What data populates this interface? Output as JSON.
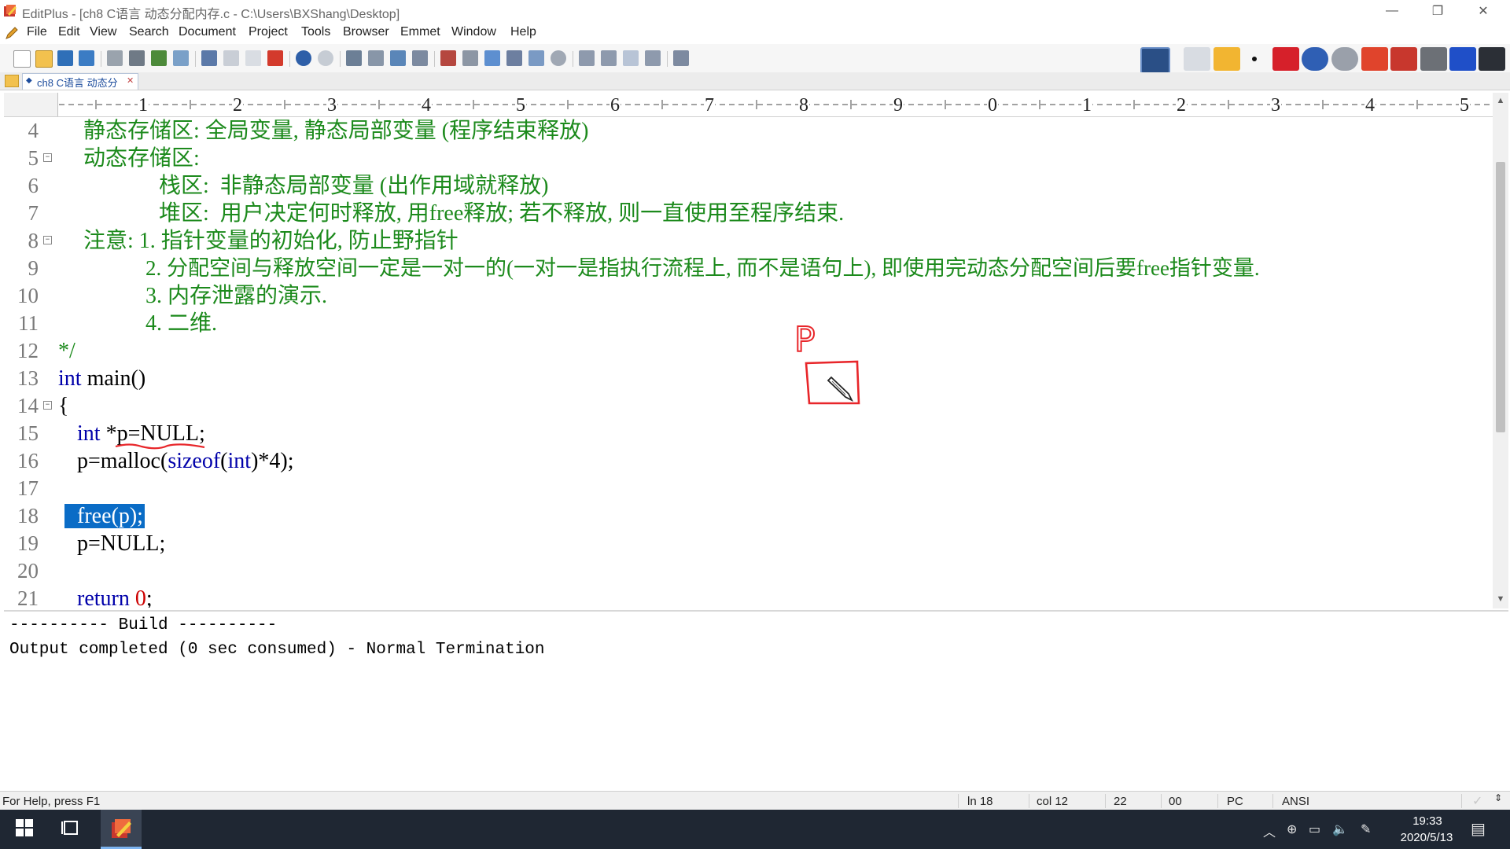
{
  "window": {
    "title": "EditPlus - [ch8 C语言 动态分配内存.c - C:\\Users\\BXShang\\Desktop]",
    "controls": {
      "minimize": "—",
      "restore": "❐",
      "close": "✕"
    }
  },
  "menu": [
    "File",
    "Edit",
    "View",
    "Search",
    "Document",
    "Project",
    "Tools",
    "Browser",
    "Emmet",
    "Window",
    "Help"
  ],
  "tab": {
    "label": "ch8 C语言 动态分"
  },
  "ruler": {
    "labels": [
      "1",
      "2",
      "3",
      "4",
      "5",
      "6",
      "7",
      "8",
      "9",
      "0",
      "1",
      "2",
      "3",
      "4",
      "5"
    ]
  },
  "editor": {
    "lines": [
      {
        "num": "4",
        "text": "静态存储区: 全局变量, 静态局部变量 (程序结束释放)"
      },
      {
        "num": "5",
        "text": "动态存储区:"
      },
      {
        "num": "6",
        "text": "栈区:  非静态局部变量 (出作用域就释放)"
      },
      {
        "num": "7",
        "text": "堆区:  用户决定何时释放, 用free释放; 若不释放, 则一直使用至程序结束."
      },
      {
        "num": "8",
        "text": "注意: 1. 指针变量的初始化, 防止野指针"
      },
      {
        "num": "9",
        "text": "2. 分配空间与释放空间一定是一对一的(一对一是指执行流程上, 而不是语句上), 即使用完动态分配空间后要free指针变量."
      },
      {
        "num": "10",
        "text": "3. 内存泄露的演示."
      },
      {
        "num": "11",
        "text": "4. 二维."
      },
      {
        "num": "12",
        "text": "*/"
      },
      {
        "num": "13",
        "kw": "int",
        "rest": " main()"
      },
      {
        "num": "14",
        "text": "{"
      },
      {
        "num": "15",
        "kw": "int",
        "rest": " *p=NULL;"
      },
      {
        "num": "16",
        "text": "p=malloc(",
        "kw1": "sizeof",
        "mid": "(",
        "kw2": "int",
        "end": ")*4);"
      },
      {
        "num": "17",
        "text": ""
      },
      {
        "num": "18",
        "text": "free(p);"
      },
      {
        "num": "19",
        "text": "p=NULL;"
      },
      {
        "num": "20",
        "text": ""
      },
      {
        "num": "21",
        "kw": "return",
        "sp": " ",
        "numval": "0",
        "end": ";"
      }
    ],
    "annotation_text": "P"
  },
  "output": {
    "lines": [
      "---------- Build ----------",
      "Output completed (0 sec consumed) - Normal Termination"
    ]
  },
  "status": {
    "help": "For Help, press F1",
    "line": "ln 18",
    "col": "col 12",
    "total": "22",
    "code": "00",
    "mode": "PC",
    "encoding": "ANSI"
  },
  "taskbar": {
    "time": "19:33",
    "date": "2020/5/13"
  },
  "colors": {
    "comment": "#1c8a1c",
    "keyword": "#0000aa",
    "number": "#cc0000",
    "selection": "#0a6cc6",
    "annotation": "#e8262a",
    "taskbar": "#1f2733"
  }
}
